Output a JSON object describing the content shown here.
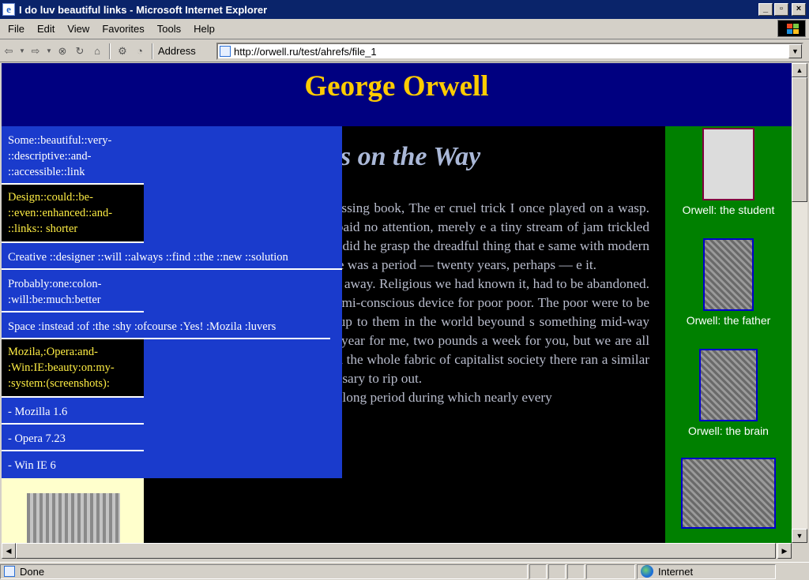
{
  "window": {
    "title": "I do luv beautiful links - Microsoft Internet Explorer",
    "min_glyph": "_",
    "max_glyph": "▫",
    "close_glyph": "×"
  },
  "menubar": [
    {
      "label": "File"
    },
    {
      "label": "Edit"
    },
    {
      "label": "View"
    },
    {
      "label": "Favorites"
    },
    {
      "label": "Tools"
    },
    {
      "label": "Help"
    }
  ],
  "toolbar": {
    "address_label": "Address",
    "address_value": "http://orwell.ru/test/ahrefs/file_1",
    "dropdown_glyph": "▼"
  },
  "page": {
    "banner_title": "George Orwell",
    "article_title": "es on the Way",
    "paragraphs": [
      "Muggeridge’s brilliant and depressing book, The er cruel trick I once played on a wasp. He was d I cut him in half. He paid no attention, merely e a tiny stream of jam trickled out of his severed ed to fly away did he grasp the dreadful thing that e same with modern man. The thing that has been here was a period — twenty years, perhaps — e it.",
      "essary that the soul should be cut away. Religious we had known it, had to be abandoned. By the eady in essence a lie, a semi-conscious device for poor poor. The poor were to be contented with uld all be made up to them in the world beyound s something mid-way between Kew gardens and a d a year for me, two pounds a week for you, but we are all the children of God. And through the whole fabric of capitalist society there ran a similar lie, which it was absolutely necessary to rip out.",
      "Consequently there was a long period during which nearly every"
    ],
    "captions": [
      "Orwell: the student",
      "Orwell: the father",
      "Orwell: the brain"
    ],
    "nav_links": [
      "Some::beautiful::very- ::descriptive::and- ::accessible::link",
      "Design::could::be- ::even::enhanced::and- ::links:: shorter",
      "Creative ::designer ::will ::always ::find ::the ::new ::solution",
      "Probably:one:colon- :will:be:much:better",
      "Space :instead :of :the :shy :ofcourse :Yes! :Mozila :luvers",
      "Mozila,:Opera:and- :Win:IE:beauty:on:my- :system:(screenshots):",
      "- Mozilla 1.6",
      "- Opera 7.23",
      "- Win IE 6"
    ]
  },
  "status": {
    "text": "Done",
    "zone": "Internet"
  },
  "colors": {
    "banner_bg": "#000080",
    "banner_text": "#ffcc00",
    "nav_bg": "#1a3bcc",
    "right_col_bg": "#008000",
    "left_col_bg": "#ffffcc"
  }
}
